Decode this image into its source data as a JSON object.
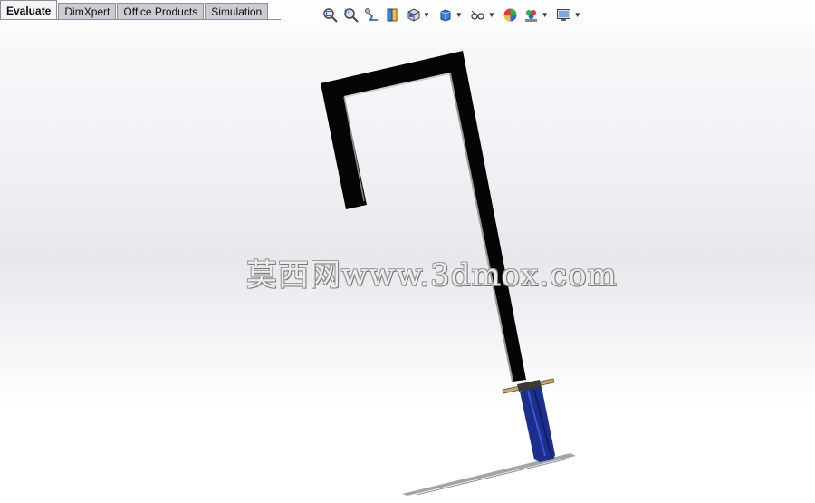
{
  "tabs": [
    {
      "label": "Evaluate",
      "active": true
    },
    {
      "label": "DimXpert",
      "active": false
    },
    {
      "label": "Office Products",
      "active": false
    },
    {
      "label": "Simulation",
      "active": false
    }
  ],
  "toolbar": {
    "icons": [
      "zoom-to-fit-icon",
      "zoom-to-area-icon",
      "previous-view-icon",
      "section-view-icon",
      "view-orientation-icon",
      "display-style-icon",
      "hide-show-items-icon",
      "edit-appearance-icon",
      "apply-scene-icon",
      "view-settings-icon"
    ]
  },
  "watermark": "莫西网www.3dmox.com",
  "colors": {
    "frame": "#050505",
    "handle": "#1c2f8f",
    "guard": "#c7a86a",
    "background_light": "#ffffff",
    "background_band": "#e6e8ec"
  }
}
